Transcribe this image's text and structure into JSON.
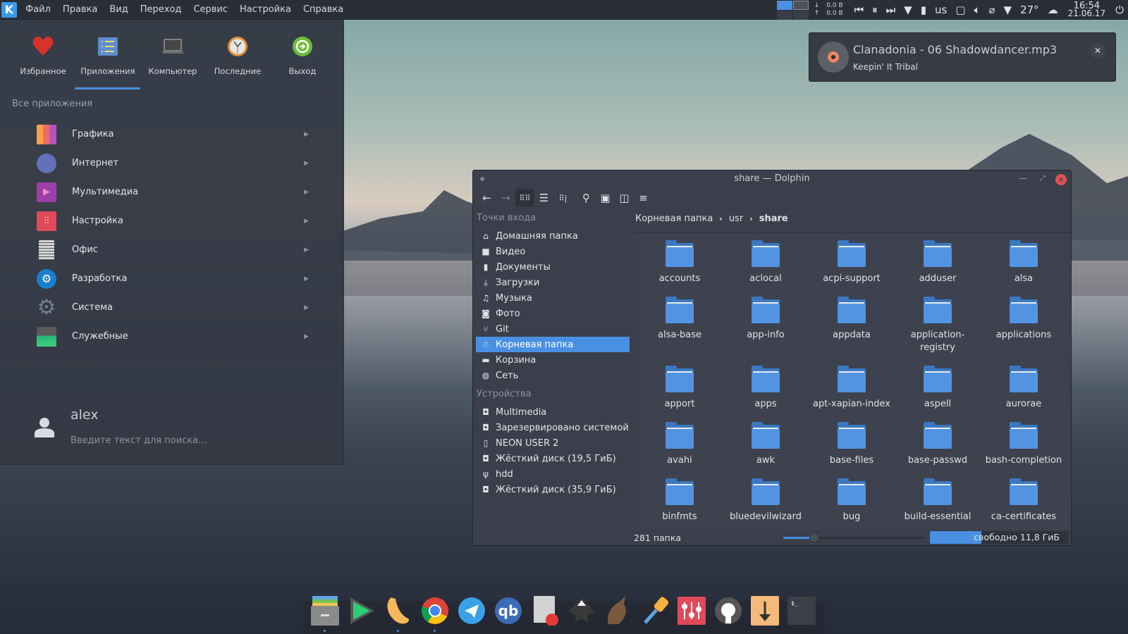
{
  "top_panel": {
    "menu": [
      "Файл",
      "Правка",
      "Вид",
      "Переход",
      "Сервис",
      "Настройка",
      "Справка"
    ],
    "net_down": "0.0 B",
    "net_up": "0.0 B",
    "keyboard_layout": "us",
    "temperature": "27°",
    "time": "16:54",
    "date": "21.06.17",
    "icons": [
      "kde-menu-icon",
      "pager",
      "media-prev-icon",
      "media-pause-icon",
      "media-next-icon",
      "expand-icon",
      "usb-device-icon",
      "display-icon",
      "volume-icon",
      "clipboard-icon",
      "tray-expand-icon",
      "weather-icon",
      "power-icon"
    ]
  },
  "launcher": {
    "tabs": [
      {
        "label": "Избранное",
        "icon": "heart-icon"
      },
      {
        "label": "Приложения",
        "icon": "applications-list-icon",
        "active": true
      },
      {
        "label": "Компьютер",
        "icon": "computer-icon"
      },
      {
        "label": "Последние",
        "icon": "clock-icon"
      },
      {
        "label": "Выход",
        "icon": "logout-icon"
      }
    ],
    "section_label": "Все приложения",
    "categories": [
      {
        "label": "Графика",
        "icon": "graphics-icon"
      },
      {
        "label": "Интернет",
        "icon": "internet-icon"
      },
      {
        "label": "Мультимедиа",
        "icon": "multimedia-icon"
      },
      {
        "label": "Настройка",
        "icon": "settings-icon"
      },
      {
        "label": "Офис",
        "icon": "office-icon"
      },
      {
        "label": "Разработка",
        "icon": "development-icon"
      },
      {
        "label": "Система",
        "icon": "system-icon"
      },
      {
        "label": "Служебные",
        "icon": "utilities-icon"
      }
    ],
    "user_name": "alex",
    "search_placeholder": "Введите текст для поиска..."
  },
  "notification": {
    "title": "Clanadonia - 06 Shadowdancer.mp3",
    "subtitle": "Keepin' It Tribal",
    "close": "✕"
  },
  "dolphin": {
    "title": "share — Dolphin",
    "places_header": "Точки входа",
    "places": [
      {
        "label": "Домашняя папка",
        "icon": "⌂"
      },
      {
        "label": "Видео",
        "icon": "■"
      },
      {
        "label": "Документы",
        "icon": "▮"
      },
      {
        "label": "Загрузки",
        "icon": "⤓"
      },
      {
        "label": "Музыка",
        "icon": "♫"
      },
      {
        "label": "Фото",
        "icon": "◙"
      },
      {
        "label": "Git",
        "icon": "⑂"
      },
      {
        "label": "Корневая папка",
        "icon": "☃",
        "selected": true
      },
      {
        "label": "Корзина",
        "icon": "▬"
      },
      {
        "label": "Сеть",
        "icon": "◍"
      }
    ],
    "devices_header": "Устройства",
    "devices": [
      {
        "label": "Multimedia",
        "icon": "◘"
      },
      {
        "label": "Зарезервировано системой",
        "icon": "◘"
      },
      {
        "label": "NEON USER 2",
        "icon": "▯"
      },
      {
        "label": "Жёсткий диск (19,5 ГиБ)",
        "icon": "◘"
      },
      {
        "label": "hdd",
        "icon": "ψ"
      },
      {
        "label": "Жёсткий диск (35,9 ГиБ)",
        "icon": "◘"
      }
    ],
    "breadcrumb": [
      "Корневая папка",
      "usr",
      "share"
    ],
    "folders": [
      "accounts",
      "aclocal",
      "acpi-support",
      "adduser",
      "alsa",
      "alsa-base",
      "app-info",
      "appdata",
      "application-registry",
      "applications",
      "apport",
      "apps",
      "apt-xapian-index",
      "aspell",
      "aurorae",
      "avahi",
      "awk",
      "base-files",
      "base-passwd",
      "bash-completion",
      "binfmts",
      "bluedevilwizard",
      "bug",
      "build-essential",
      "ca-certificates"
    ],
    "status_count": "281 папка",
    "zoom_level": 0.22,
    "free_space_text": "свободно 11,8 ГиБ",
    "used_fraction": 0.37
  },
  "dock": {
    "apps": [
      "file-manager-icon",
      "play-store-icon",
      "mango-icon",
      "chrome-icon",
      "telegram-icon",
      "qbittorrent-icon",
      "text-editor-icon",
      "inkscape-icon",
      "krita-icon",
      "color-picker-icon",
      "mixer-icon",
      "github-icon",
      "downloader-icon",
      "terminal-icon"
    ]
  },
  "colors": {
    "accent": "#4a90e2",
    "close": "#e05254",
    "panel": "#2a2e37"
  }
}
